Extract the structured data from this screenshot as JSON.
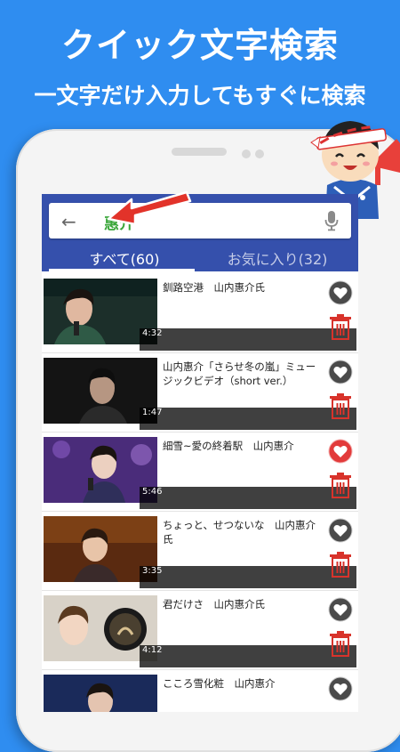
{
  "promo": {
    "headline": "クイック文字検索",
    "subline": "一文字だけ入力してもすぐに検索"
  },
  "search": {
    "query": "惠介"
  },
  "tabs": [
    {
      "label": "すべて(60)",
      "active": true
    },
    {
      "label": "お気に入り(32)",
      "active": false
    }
  ],
  "items": [
    {
      "title": "釧路空港　山内惠介氏",
      "duration": "4:32",
      "favorite": false
    },
    {
      "title": "山内惠介「さらせ冬の嵐」ミュージックビデオ（short ver.）",
      "duration": "1:47",
      "favorite": false
    },
    {
      "title": "細雪~愛の終着駅　山内惠介",
      "duration": "5:46",
      "favorite": true
    },
    {
      "title": "ちょっと、せつないな　山内惠介氏",
      "duration": "3:35",
      "favorite": false
    },
    {
      "title": "君だけさ　山内惠介氏",
      "duration": "4:12",
      "favorite": false
    },
    {
      "title": "こころ雪化粧　山内惠介",
      "duration": "",
      "favorite": false
    }
  ],
  "colors": {
    "background": "#2f8df0",
    "appbar": "#3550ac",
    "query": "#3aa63a",
    "favorite_active": "#e23a3a",
    "trash": "#d8332b"
  }
}
